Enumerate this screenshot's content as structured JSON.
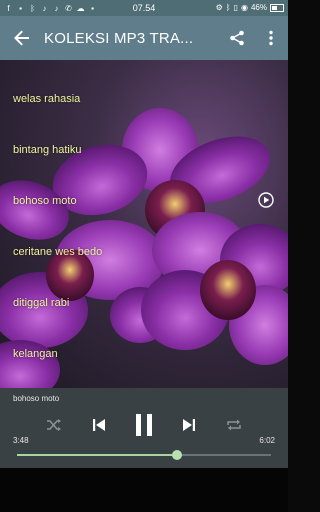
{
  "status_bar": {
    "time": "07.54",
    "battery": "46%",
    "left_icons": [
      "facebook-icon",
      "image-icon",
      "bluetooth-icon",
      "music-icon",
      "music-icon",
      "phone-icon",
      "cloud-icon",
      "image-icon"
    ],
    "right_icons": [
      "settings-icon",
      "bluetooth-icon",
      "vibrate-icon",
      "eye-icon",
      "battery-icon",
      "charging-icon"
    ]
  },
  "app_bar": {
    "title": "KOLEKSI MP3 TRA...",
    "back_icon": "arrow-back-icon",
    "share_icon": "share-icon",
    "more_icon": "more-vert-icon",
    "color": "#607d8b"
  },
  "songs": [
    {
      "title": "welas rahasia"
    },
    {
      "title": "bintang hatiku"
    },
    {
      "title": "bohoso moto"
    },
    {
      "title": "ceritane wes bedo"
    },
    {
      "title": "ditiggal rabi"
    },
    {
      "title": "kelangan"
    }
  ],
  "player": {
    "now_playing": "bohoso moto",
    "elapsed": "3:48",
    "duration": "6:02",
    "progress": 0.63,
    "accent": "#a8d5a0"
  }
}
